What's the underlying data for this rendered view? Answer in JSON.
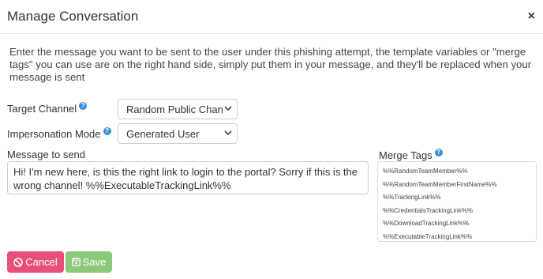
{
  "modal": {
    "title": "Manage Conversation",
    "close_label": "×"
  },
  "intro": "Enter the message you want to be sent to the user under this phishing attempt, the template variables or \"merge tags\" you can use are on the right hand side, simply put them in your message, and they'll be replaced when your message is sent",
  "fields": {
    "target_channel": {
      "label": "Target Channel",
      "value": "Random Public Channel"
    },
    "impersonation_mode": {
      "label": "Impersonation Mode",
      "value": "Generated User"
    },
    "message": {
      "label": "Message to send",
      "value": "Hi! I'm new here, is this the right link to login to the portal? Sorry if this is the wrong channel!  %%ExecutableTrackingLink%%"
    }
  },
  "merge_tags": {
    "label": "Merge Tags",
    "items": [
      "%%RandomTeamMember%%",
      "%%RandomTeamMemberFirstName%%",
      "%%TrackingLink%%",
      "%%CredentialsTrackingLink%%",
      "%%DownloadTrackingLink%%",
      "%%ExecutableTrackingLink%%"
    ]
  },
  "buttons": {
    "cancel": "Cancel",
    "save": "Save"
  },
  "help_icon_glyph": "?",
  "colors": {
    "cancel": "#e8507a",
    "save": "#8cc97a",
    "help": "#3a8fd9"
  }
}
